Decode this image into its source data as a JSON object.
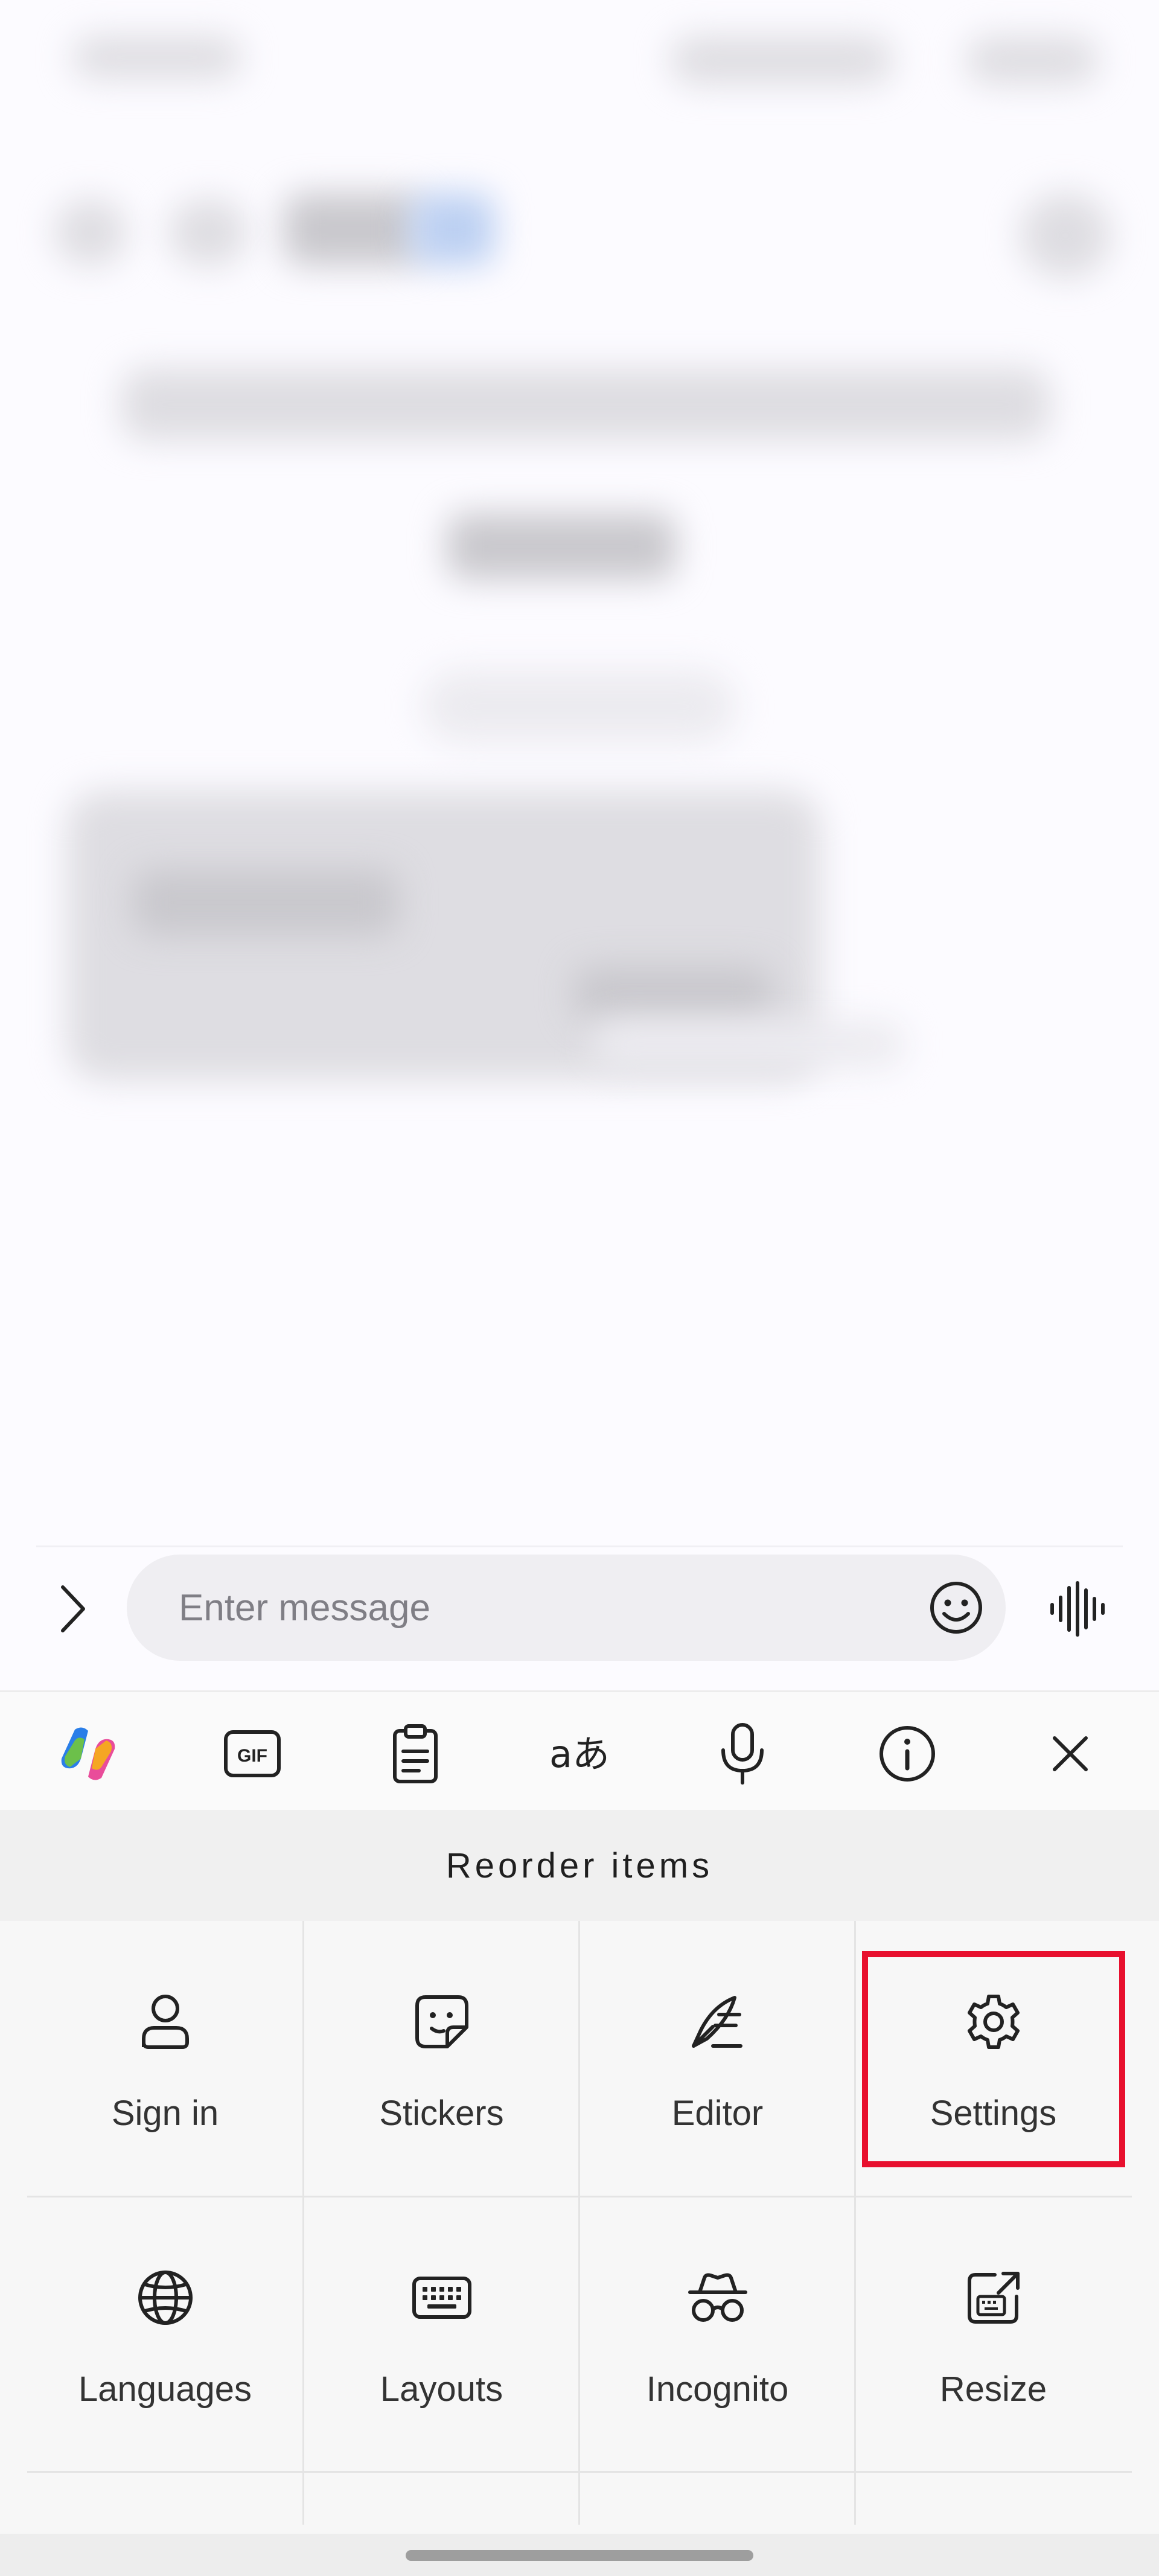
{
  "composer": {
    "placeholder": "Enter message",
    "expand_icon": "chevron-right-icon",
    "emoji_icon": "smiley-icon",
    "voice_icon": "voice-waveform-icon"
  },
  "toolbar": {
    "items": [
      {
        "name": "copilot",
        "icon": "copilot-icon"
      },
      {
        "name": "gif",
        "icon": "gif-icon",
        "label": "GIF"
      },
      {
        "name": "clipboard",
        "icon": "clipboard-icon"
      },
      {
        "name": "translate",
        "icon": "translate-icon",
        "label": "aあ"
      },
      {
        "name": "microphone",
        "icon": "microphone-icon"
      },
      {
        "name": "info",
        "icon": "info-icon"
      },
      {
        "name": "close",
        "icon": "close-icon"
      }
    ]
  },
  "reorder": {
    "title": "Reorder items"
  },
  "grid": {
    "items": [
      {
        "label": "Sign in",
        "icon": "person-icon"
      },
      {
        "label": "Stickers",
        "icon": "sticker-icon"
      },
      {
        "label": "Editor",
        "icon": "pen-icon"
      },
      {
        "label": "Settings",
        "icon": "gear-icon",
        "highlighted": true
      },
      {
        "label": "Languages",
        "icon": "globe-icon"
      },
      {
        "label": "Layouts",
        "icon": "keyboard-icon"
      },
      {
        "label": "Incognito",
        "icon": "incognito-icon"
      },
      {
        "label": "Resize",
        "icon": "resize-icon"
      }
    ]
  },
  "colors": {
    "highlight": "#e8102e",
    "copilot_blue": "#2a7ee8",
    "copilot_green": "#6cc04a",
    "copilot_pink": "#e94c9a",
    "copilot_orange": "#f5a623"
  }
}
